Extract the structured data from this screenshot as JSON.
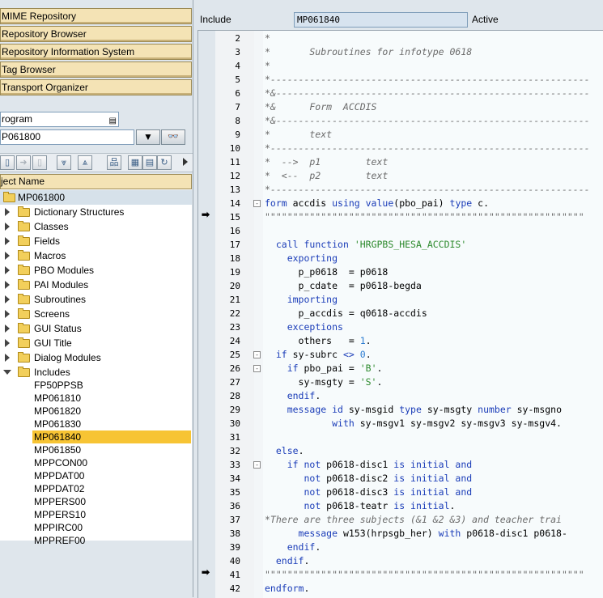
{
  "nav": {
    "buttons": [
      "MIME Repository",
      "Repository Browser",
      "Repository Information System",
      "Tag Browser",
      "Transport Organizer"
    ]
  },
  "object_type": {
    "value": "rogram"
  },
  "object_name": {
    "value": "P061800"
  },
  "tree": {
    "header": "ject Name",
    "root": "MP061800",
    "folders": [
      "Dictionary Structures",
      "Classes",
      "Fields",
      "Macros",
      "PBO Modules",
      "PAI Modules",
      "Subroutines",
      "Screens",
      "GUI Status",
      "GUI Title",
      "Dialog Modules",
      "Includes"
    ],
    "includes": [
      "FP50PPSB",
      "MP061810",
      "MP061820",
      "MP061830",
      "MP061840",
      "MP061850",
      "MPPCON00",
      "MPPDAT00",
      "MPPDAT02",
      "MPPERS00",
      "MPPERS10",
      "MPPIRC00",
      "MPPREF00"
    ],
    "selected_include": "MP061840"
  },
  "header": {
    "label": "Include",
    "value": "MP061840",
    "status": "Active"
  },
  "editor": {
    "lines": [
      {
        "n": "2",
        "t": "*",
        "c": "cm"
      },
      {
        "n": "3",
        "t": "*       Subroutines for infotype 0618",
        "c": "cm"
      },
      {
        "n": "4",
        "t": "*",
        "c": "cm"
      },
      {
        "n": "5",
        "t": "*---------------------------------------------------------",
        "c": "cm"
      },
      {
        "n": "6",
        "t": "*&--------------------------------------------------------",
        "c": "cm"
      },
      {
        "n": "7",
        "t": "*&      Form  ACCDIS",
        "c": "cm"
      },
      {
        "n": "8",
        "t": "*&--------------------------------------------------------",
        "c": "cm"
      },
      {
        "n": "9",
        "t": "*       text",
        "c": "cm"
      },
      {
        "n": "10",
        "t": "*---------------------------------------------------------",
        "c": "cm"
      },
      {
        "n": "11",
        "t": "*  -->  p1        text",
        "c": "cm"
      },
      {
        "n": "12",
        "t": "*  <--  p2        text",
        "c": "cm"
      },
      {
        "n": "13",
        "t": "*---------------------------------------------------------",
        "c": "cm"
      },
      {
        "n": "14",
        "h": "<span class=\"kw\">form</span> accdis <span class=\"kw\">using value</span>(pbo_pai) <span class=\"kw\">type</span> c."
      },
      {
        "n": "15",
        "t": "\"\"\"\"\"\"\"\"\"\"\"\"\"\"\"\"\"\"\"\"\"\"\"\"\"\"\"\"\"\"\"\"\"\"\"\"\"\"\"\"\"\"\"\"\"\"\"\"\"\"\"\"\"\"\"\"\"",
        "c": "cm"
      },
      {
        "n": "16",
        "t": ""
      },
      {
        "n": "17",
        "h": "  <span class=\"kw\">call function</span> <span class=\"st\">'HRGPBS_HESA_ACCDIS'</span>"
      },
      {
        "n": "18",
        "h": "    <span class=\"kw\">exporting</span>"
      },
      {
        "n": "19",
        "h": "      p_p0618  = p0618"
      },
      {
        "n": "20",
        "h": "      p_cdate  = p0618-begda"
      },
      {
        "n": "21",
        "h": "    <span class=\"kw\">importing</span>"
      },
      {
        "n": "22",
        "h": "      p_accdis = q0618-accdis"
      },
      {
        "n": "23",
        "h": "    <span class=\"kw\">exceptions</span>"
      },
      {
        "n": "24",
        "h": "      others   = <span class=\"nu\">1</span>."
      },
      {
        "n": "25",
        "h": "  <span class=\"kw\">if</span> sy-subrc <span class=\"kw\">&lt;&gt;</span> <span class=\"nu\">0</span>."
      },
      {
        "n": "26",
        "h": "    <span class=\"kw\">if</span> pbo_pai = <span class=\"st\">'B'</span>."
      },
      {
        "n": "27",
        "h": "      sy-msgty = <span class=\"st\">'S'</span>."
      },
      {
        "n": "28",
        "h": "    <span class=\"kw\">endif</span>."
      },
      {
        "n": "29",
        "h": "    <span class=\"kw\">message id</span> sy-msgid <span class=\"kw\">type</span> sy-msgty <span class=\"kw\">number</span> sy-msgno"
      },
      {
        "n": "30",
        "h": "            <span class=\"kw\">with</span> sy-msgv1 sy-msgv2 sy-msgv3 sy-msgv4."
      },
      {
        "n": "31",
        "t": ""
      },
      {
        "n": "32",
        "h": "  <span class=\"kw\">else</span>."
      },
      {
        "n": "33",
        "h": "    <span class=\"kw\">if not</span> p0618-disc1 <span class=\"kw\">is initial and</span>"
      },
      {
        "n": "34",
        "h": "       <span class=\"kw\">not</span> p0618-disc2 <span class=\"kw\">is initial and</span>"
      },
      {
        "n": "35",
        "h": "       <span class=\"kw\">not</span> p0618-disc3 <span class=\"kw\">is initial and</span>"
      },
      {
        "n": "36",
        "h": "       <span class=\"kw\">not</span> p0618-teatr <span class=\"kw\">is initial</span>."
      },
      {
        "n": "37",
        "t": "*There are three subjects (&1 &2 &3) and teacher trai",
        "c": "cm"
      },
      {
        "n": "38",
        "h": "      <span class=\"kw\">message</span> w153(hrpsgb_her) <span class=\"kw\">with</span> p0618-disc1 p0618-"
      },
      {
        "n": "39",
        "h": "    <span class=\"kw\">endif</span>."
      },
      {
        "n": "40",
        "h": "  <span class=\"kw\">endif</span>."
      },
      {
        "n": "41",
        "t": "\"\"\"\"\"\"\"\"\"\"\"\"\"\"\"\"\"\"\"\"\"\"\"\"\"\"\"\"\"\"\"\"\"\"\"\"\"\"\"\"\"\"\"\"\"\"\"\"\"\"\"\"\"\"\"\"\"",
        "c": "cm"
      },
      {
        "n": "42",
        "h": "<span class=\"kw\">endform</span>."
      }
    ],
    "fold_markers": {
      "14": "-",
      "25": "-",
      "26": "-",
      "33": "-"
    }
  }
}
